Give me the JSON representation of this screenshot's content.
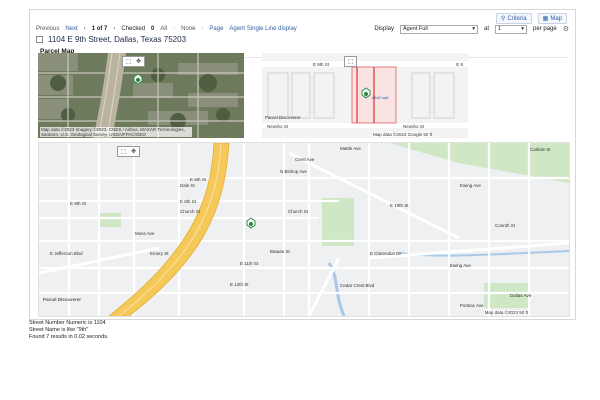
{
  "top_buttons": {
    "criteria": "Criteria",
    "map": "Map"
  },
  "nav": {
    "previous": "Previous",
    "next": "Next",
    "position": "1 of 7",
    "checked_label": "Checked",
    "checked_count": "0",
    "all": "All",
    "none": "None",
    "page": "Page",
    "display_link": "Agent Single Line display",
    "display_label": "Display",
    "display_value": "Agent Full",
    "at_label": "at",
    "per_page_value": "1",
    "per_page_label": "per page"
  },
  "address": "1104 E 9th Street, Dallas, Texas 75203",
  "section_title": "Parcel Map",
  "maps": {
    "satellite_attribution": "Map data ©2023 Imagery ©2023, CNES / Airbus, MAXAR Technologies, Sanborn, U.S. Geological Survey, USDA/FPAC/GEO",
    "parcel_attribution": "Map data ©2023 Google 50 ft",
    "street_attribution": "Map data ©2023 50 ft",
    "parcel_streets": [
      "E 9th St",
      "E 9",
      "Parcel Discoverer",
      "Neosho St",
      "Neosho St"
    ],
    "street_labels": [
      "E 6th St",
      "Dale St",
      "E 8th St",
      "Church St",
      "E 9th St",
      "Church St",
      "E 10th St",
      "Ewing Ave",
      "Mattle Ave",
      "Crest Ave",
      "N Bishop Ave",
      "E 11th St",
      "Moss Ave",
      "E Jefferson Blvd",
      "Emery St",
      "E Clarendon Dr",
      "E 12th St",
      "Bataan St",
      "Cedar Crest Blvd",
      "Carlisle St",
      "Ewing Ave",
      "Corinth St",
      "Dallas Ave",
      "Pontiac Ave"
    ],
    "parcel_marker_label": "8842 sqft"
  },
  "footer": {
    "line1": "Street Number Numeric is 1104",
    "line2": "Street Name is like \"9th\"",
    "line3": "Found 7 results in 0.02 seconds."
  },
  "colors": {
    "link": "#2f5fa8",
    "highway": "#f5c85a",
    "parcel_red": "#e2494c",
    "map_bg": "#eef0f1",
    "park": "#cfe7c4",
    "water": "#a8c8e8"
  }
}
